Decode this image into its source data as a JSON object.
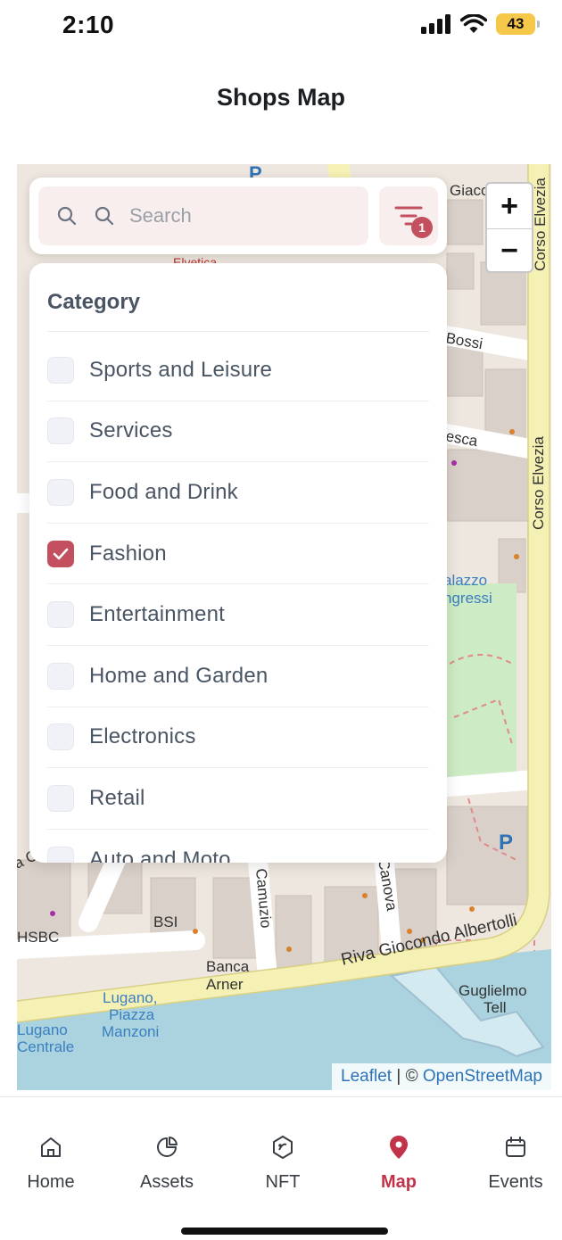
{
  "status_bar": {
    "time": "2:10",
    "battery": "43"
  },
  "header": {
    "title": "Shops Map"
  },
  "search": {
    "placeholder": "Search"
  },
  "filter": {
    "badge_count": "1"
  },
  "zoom": {
    "in_label": "+",
    "out_label": "−"
  },
  "category_panel": {
    "title": "Category",
    "items": [
      {
        "label": "Sports and Leisure",
        "checked": false
      },
      {
        "label": "Services",
        "checked": false
      },
      {
        "label": "Food and Drink",
        "checked": false
      },
      {
        "label": "Fashion",
        "checked": true
      },
      {
        "label": "Entertainment",
        "checked": false
      },
      {
        "label": "Home and Garden",
        "checked": false
      },
      {
        "label": "Electronics",
        "checked": false
      },
      {
        "label": "Retail",
        "checked": false
      },
      {
        "label": "Auto and Moto",
        "checked": false
      }
    ]
  },
  "map": {
    "labels": {
      "corso_elvezia_1": "Corso Elvezia",
      "corso_elvezia_2": "Corso Elvezia",
      "bossi": "Bossi",
      "esca": "esca",
      "palazzo": "alazzo",
      "congressi": "ngressi",
      "riva": "Riva Giocondo Albertolli",
      "camuzio": "Camuzio",
      "canova": "Canova",
      "canova_left": "a Canov",
      "bsi": "BSI",
      "hsbc": "HSBC",
      "banca": "Banca",
      "arner": "Arner",
      "lugano_piazza_1": "Lugano,",
      "lugano_piazza_2": "Piazza",
      "lugano_piazza_3": "Manzoni",
      "lugano_centrale_1": "Lugano",
      "lugano_centrale_2": "Centrale",
      "guglielmo_1": "Guglielmo",
      "guglielmo_2": "Tell",
      "giacco": "Giacc",
      "elvetica": "Elvetica"
    },
    "attribution": {
      "leaflet": "Leaflet",
      "separator": " | © ",
      "osm": "OpenStreetMap"
    }
  },
  "bottom_nav": {
    "items": [
      {
        "label": "Home",
        "icon": "home-icon",
        "active": false
      },
      {
        "label": "Assets",
        "icon": "pie-chart-icon",
        "active": false
      },
      {
        "label": "NFT",
        "icon": "nft-icon",
        "active": false
      },
      {
        "label": "Map",
        "icon": "map-pin-icon",
        "active": true
      },
      {
        "label": "Events",
        "icon": "calendar-icon",
        "active": false
      }
    ]
  },
  "colors": {
    "accent": "#c2334a",
    "checkbox_checked": "#c2505e",
    "search_bg": "#f8eeee"
  }
}
